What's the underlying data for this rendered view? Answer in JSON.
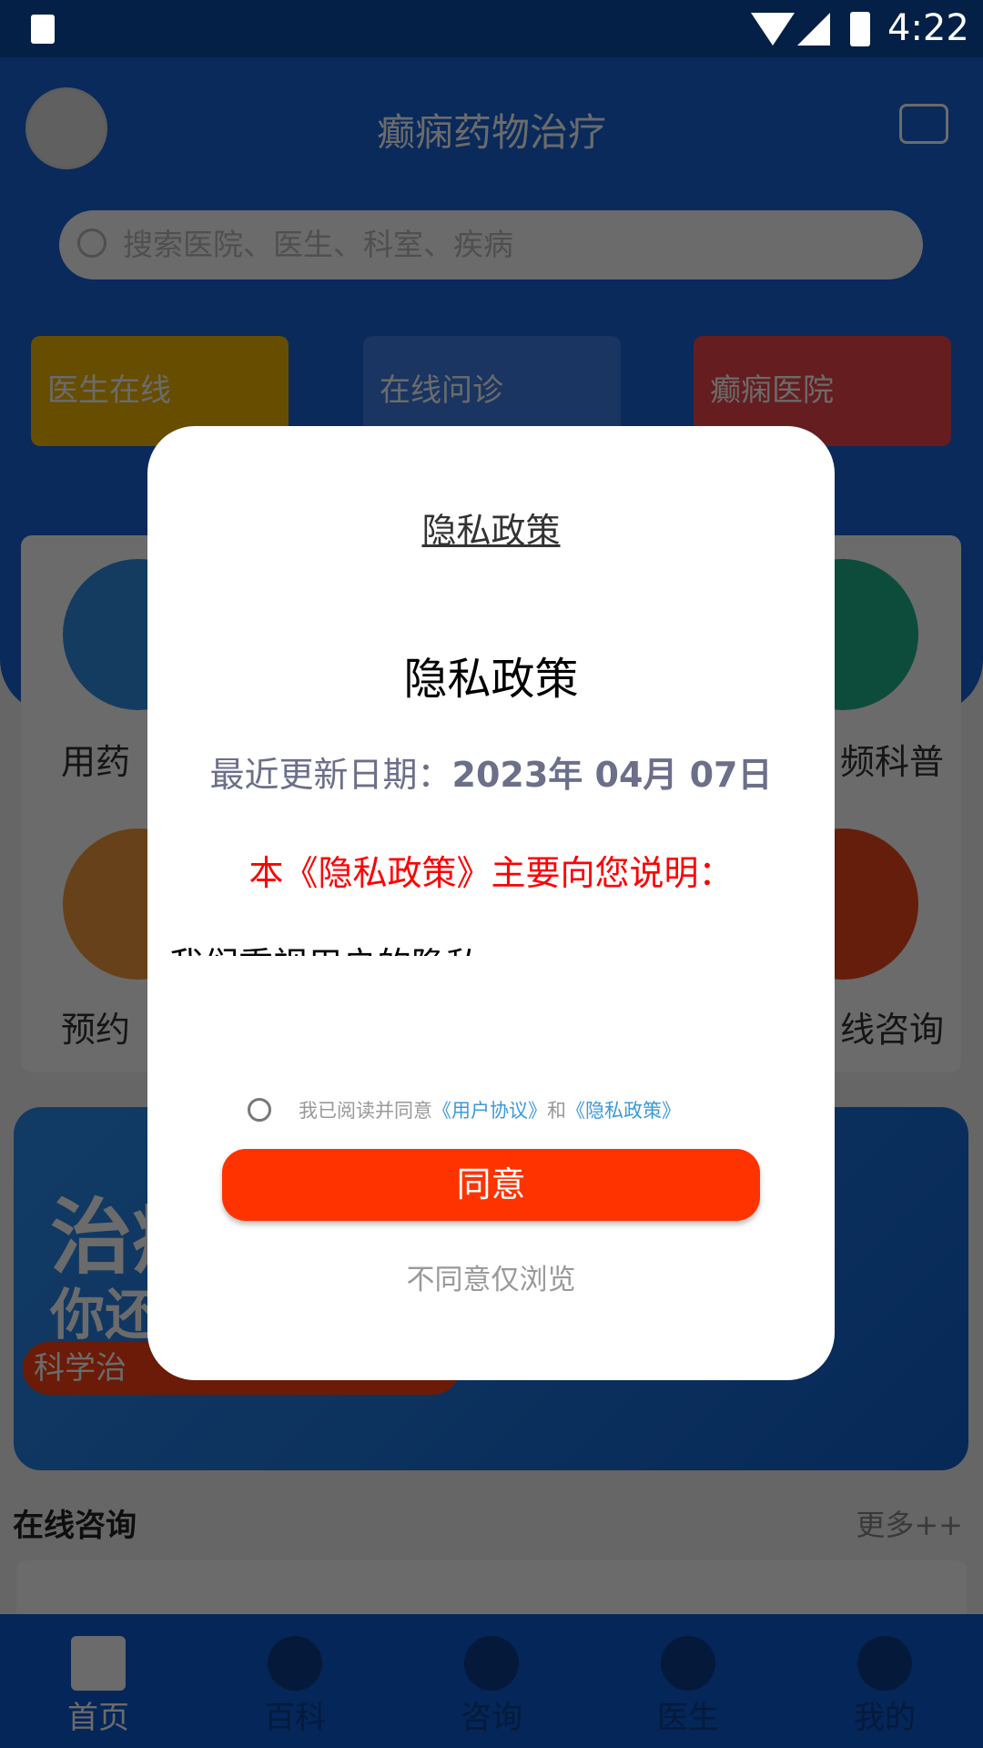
{
  "status": {
    "time": "4:22"
  },
  "header": {
    "title": "癫痫药物治疗"
  },
  "search": {
    "placeholder": "搜索医院、医生、科室、疾病"
  },
  "cards": [
    {
      "label": "医生在线",
      "color": "#f5b800"
    },
    {
      "label": "在线问诊",
      "color": "#3d7ee8"
    },
    {
      "label": "癫痫医院",
      "color": "#f0454a"
    }
  ],
  "grid": {
    "items": [
      {
        "label": "用药",
        "color": "#2f8fe8"
      },
      {
        "label": "频科普",
        "color": "#1fb48a"
      },
      {
        "label": "预约",
        "color": "#f59a3c"
      },
      {
        "label": "线咨询",
        "color": "#f0471c"
      }
    ]
  },
  "banner": {
    "line1": "治癫",
    "line2": "你还",
    "pill": "科学治"
  },
  "section": {
    "title": "在线咨询",
    "more": "更多++"
  },
  "nav": [
    {
      "label": "首页"
    },
    {
      "label": "百科"
    },
    {
      "label": "咨询"
    },
    {
      "label": "医生"
    },
    {
      "label": "我的"
    }
  ],
  "dialog": {
    "link_title": "隐私政策",
    "title": "隐私政策",
    "date_label": "最近更新日期：",
    "date_value": "2023年 04月 07日",
    "notice": "本《隐私政策》主要向您说明：",
    "body": "我们重视用户的隐私",
    "consent_prefix": "我已阅读并同意",
    "user_agreement": "《用户协议》",
    "and": "和",
    "privacy_policy": "《隐私政策》",
    "agree": "同意",
    "disagree": "不同意仅浏览",
    "accent": "#ff3300",
    "link_color": "#3a9ad9"
  }
}
